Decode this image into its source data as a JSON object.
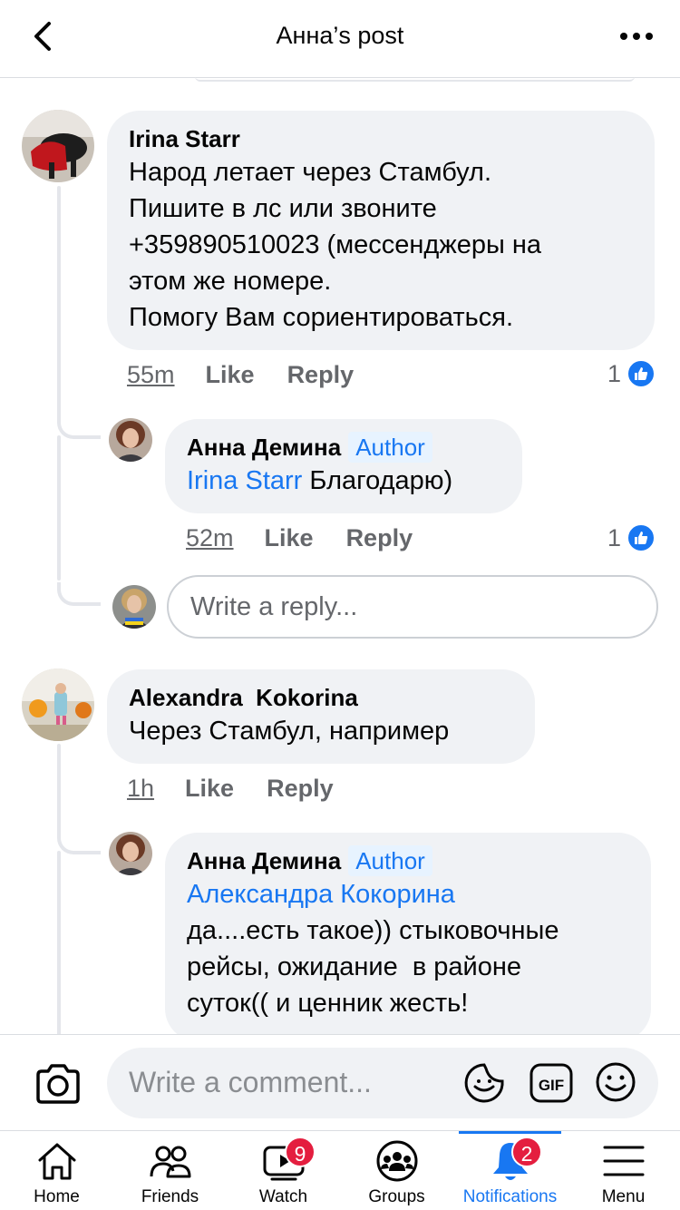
{
  "header": {
    "title": "Анна’s post"
  },
  "comments": [
    {
      "name": "Irina Starr",
      "lines": [
        "Народ летает через Стамбул.",
        "Пишите в лс или звоните",
        "+359890510023 (мессенджеры на",
        "этом же номере.",
        "Помогу Вам сориентироваться."
      ],
      "time": "55m",
      "like": "Like",
      "reply": "Reply",
      "reactions": "1"
    },
    {
      "name": "Анна Демина",
      "badge": "Author",
      "mention": "Irina Starr",
      "text": " Благодарю)",
      "time": "52m",
      "like": "Like",
      "reply": "Reply",
      "reactions": "1"
    },
    {
      "name": "Alexandra  Kokorina",
      "lines": [
        "Через Стамбул, например"
      ],
      "time": "1h",
      "like": "Like",
      "reply": "Reply"
    },
    {
      "name": "Анна Демина",
      "badge": "Author",
      "mention": "Александра Кокорина",
      "lines": [
        "да....есть такое)) стыковочные",
        "рейсы, ожидание  в районе",
        "суток(( и ценник жесть!"
      ]
    }
  ],
  "reply_input": {
    "placeholder": "Write a reply..."
  },
  "composer": {
    "placeholder": "Write a comment...",
    "gif": "GIF"
  },
  "tabs": [
    {
      "label": "Home",
      "icon": "home-icon"
    },
    {
      "label": "Friends",
      "icon": "friends-icon"
    },
    {
      "label": "Watch",
      "icon": "watch-icon",
      "badge": "9"
    },
    {
      "label": "Groups",
      "icon": "groups-icon"
    },
    {
      "label": "Notifications",
      "icon": "bell-icon",
      "badge": "2",
      "active": true
    },
    {
      "label": "Menu",
      "icon": "hamburger-icon"
    }
  ],
  "colors": {
    "accent": "#1877f2",
    "bubble": "#f0f2f5",
    "badge": "#e41e3f",
    "secondary_text": "#65676b"
  }
}
